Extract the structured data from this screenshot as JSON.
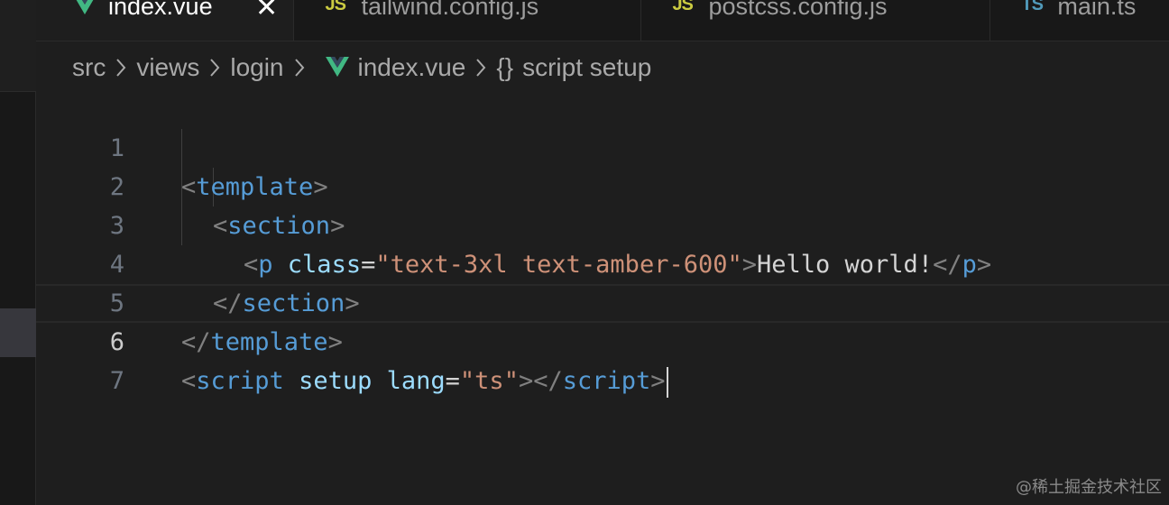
{
  "tabs": [
    {
      "label": "index.vue",
      "icon": "vue-icon",
      "active": true
    },
    {
      "label": "tailwind.config.js",
      "icon": "js-icon",
      "active": false
    },
    {
      "label": "postcss.config.js",
      "icon": "js-icon",
      "active": false
    },
    {
      "label": "main.ts",
      "icon": "ts-icon",
      "active": false
    }
  ],
  "icon_text": {
    "js": "JS",
    "ts": "TS",
    "close": "✕",
    "braces": "{}"
  },
  "breadcrumb": [
    "src",
    "views",
    "login",
    "index.vue",
    "script setup"
  ],
  "editor": {
    "line_numbers": [
      "1",
      "2",
      "3",
      "4",
      "5",
      "6",
      "7"
    ],
    "current_line": "6",
    "lines": [
      {
        "t1": "<",
        "t2": "template",
        "t3": ">"
      },
      {
        "t1": "<",
        "t2": "section",
        "t3": ">"
      },
      {
        "t1": "<",
        "t2": "p",
        "t3": " ",
        "t4": "class",
        "t5": "=",
        "t6": "\"text-3xl text-amber-600\"",
        "t7": ">",
        "t8": "Hello world!",
        "t9": "</",
        "t10": "p",
        "t11": ">"
      },
      {
        "t1": "</",
        "t2": "section",
        "t3": ">"
      },
      {
        "t1": "</",
        "t2": "template",
        "t3": ">"
      },
      {
        "t1": "<",
        "t2": "script",
        "t3": " ",
        "t4": "setup",
        "t5": " ",
        "t6": "lang",
        "t7": "=",
        "t8": "\"ts\"",
        "t9": "></",
        "t10": "script",
        "t11": ">"
      }
    ]
  },
  "colors": {
    "background": "#1e1e1e",
    "tag": "#569cd6",
    "attribute": "#9cdcfe",
    "string": "#ce9178",
    "punctuation": "#808080",
    "vue_green": "#41b883"
  },
  "watermark": "@稀土掘金技术社区"
}
